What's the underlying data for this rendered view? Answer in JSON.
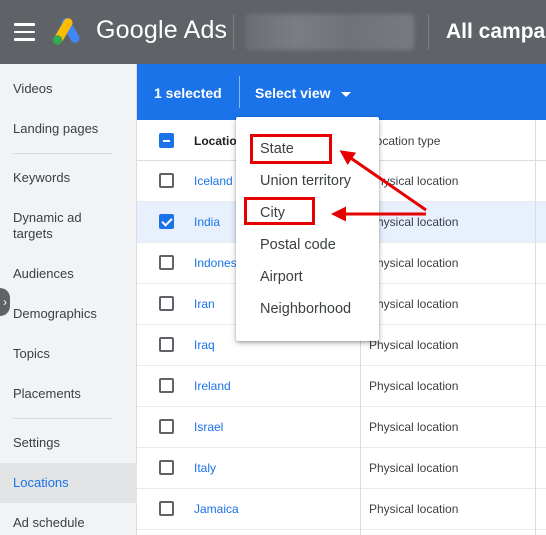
{
  "app": {
    "logo_text": "Google Ads",
    "campaign_title": "All campai",
    "brand_colors": {
      "blue": "#4285f4",
      "yellow": "#fbbc04",
      "green": "#34a853"
    }
  },
  "sidebar": {
    "items": [
      {
        "label": "Videos"
      },
      {
        "label": "Landing pages"
      },
      {
        "label": "Keywords"
      },
      {
        "label": "Dynamic ad targets"
      },
      {
        "label": "Audiences"
      },
      {
        "label": "Demographics"
      },
      {
        "label": "Topics"
      },
      {
        "label": "Placements"
      },
      {
        "label": "Settings"
      },
      {
        "label": "Locations",
        "active": true
      },
      {
        "label": "Ad schedule"
      }
    ]
  },
  "selection_bar": {
    "count_label": "1 selected",
    "select_view_label": "Select view",
    "accent": "#1a73e8"
  },
  "table": {
    "headers": {
      "location": "Location",
      "location_type": "Location type"
    },
    "rows": [
      {
        "location": "Iceland",
        "type": "Physical location",
        "checked": false
      },
      {
        "location": "India",
        "type": "Physical location",
        "checked": true
      },
      {
        "location": "Indonesia",
        "type": "Physical location",
        "checked": false
      },
      {
        "location": "Iran",
        "type": "Physical location",
        "checked": false
      },
      {
        "location": "Iraq",
        "type": "Physical location",
        "checked": false
      },
      {
        "location": "Ireland",
        "type": "Physical location",
        "checked": false
      },
      {
        "location": "Israel",
        "type": "Physical location",
        "checked": false
      },
      {
        "location": "Italy",
        "type": "Physical location",
        "checked": false
      },
      {
        "location": "Jamaica",
        "type": "Physical location",
        "checked": false
      }
    ]
  },
  "view_menu": {
    "options": [
      {
        "label": "State",
        "highlighted": true
      },
      {
        "label": "Union territory"
      },
      {
        "label": "City",
        "highlighted": true
      },
      {
        "label": "Postal code"
      },
      {
        "label": "Airport"
      },
      {
        "label": "Neighborhood"
      }
    ]
  },
  "annotation_color": "#e60000"
}
